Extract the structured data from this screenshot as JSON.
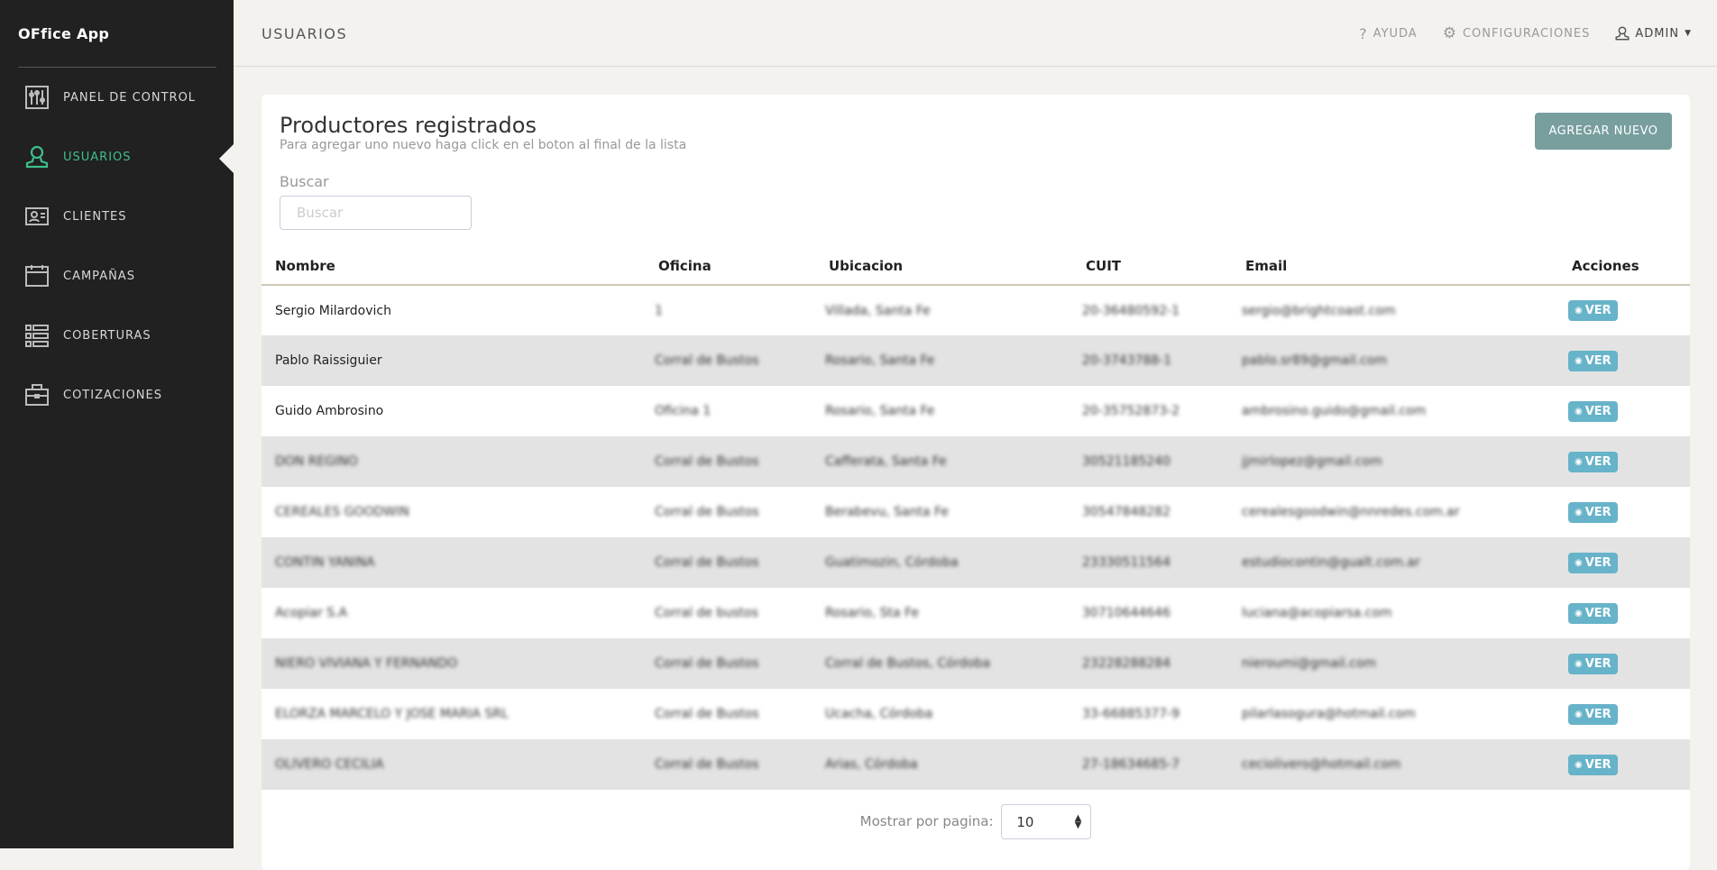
{
  "app": {
    "logo": "OFfice App"
  },
  "sidebar": {
    "items": [
      {
        "label": "PANEL DE CONTROL",
        "icon": "sliders-icon"
      },
      {
        "label": "USUARIOS",
        "icon": "user-icon",
        "active": true
      },
      {
        "label": "CLIENTES",
        "icon": "id-card-icon"
      },
      {
        "label": "CAMPAÑAS",
        "icon": "calendar-icon"
      },
      {
        "label": "COBERTURAS",
        "icon": "list-icon"
      },
      {
        "label": "COTIZACIONES",
        "icon": "briefcase-icon"
      }
    ]
  },
  "header": {
    "title": "USUARIOS",
    "help": "AYUDA",
    "settings": "CONFIGURACIONES",
    "user": "ADMIN"
  },
  "card": {
    "title": "Productores registrados",
    "subtitle": "Para agregar uno nuevo haga click en el boton al final de la lista",
    "add_label": "AGREGAR NUEVO",
    "search_label": "Buscar",
    "search_placeholder": "Buscar",
    "search_value": ""
  },
  "colors": {
    "accent": "#3fbf8a",
    "add_button": "#789e9e",
    "view_button": "#67b3c9",
    "sidebar": "#212121"
  },
  "table": {
    "headers": [
      "Nombre",
      "Oficina",
      "Ubicacion",
      "CUIT",
      "Email",
      "Acciones"
    ],
    "action_label": "VER",
    "rows": [
      [
        "Sergio Milardovich",
        "1",
        "Villada, Santa Fe",
        "20-36480592-1",
        "sergio@brightcoast.com"
      ],
      [
        "Pablo Raissiguier",
        "Corral de Bustos",
        "Rosario, Santa Fe",
        "20-3743788-1",
        "pablo.sr89@gmail.com"
      ],
      [
        "Guido Ambrosino",
        "Oficina 1",
        "Rosario, Santa Fe",
        "20-35752873-2",
        "ambrosino.guido@gmail.com"
      ],
      [
        "DON REGINO",
        "Corral de Bustos",
        "Cafferata, Santa Fe",
        "30521185240",
        "jjmirlopez@gmail.com"
      ],
      [
        "CEREALES GOODWIN",
        "Corral de Bustos",
        "Berabevu, Santa Fe",
        "30547848282",
        "cerealesgoodwin@nnredes.com.ar"
      ],
      [
        "CONTIN YANINA",
        "Corral de Bustos",
        "Guatimozin, Córdoba",
        "23330511564",
        "estudiocontin@gualt.com.ar"
      ],
      [
        "Acopiar S.A",
        "Corral de bustos",
        "Rosario, Sta Fe",
        "30710644646",
        "luciana@acopiarsa.com"
      ],
      [
        "NIERO VIVIANA Y FERNANDO",
        "Corral de Bustos",
        "Corral de Bustos, Córdoba",
        "23228288284",
        "nieroumi@gmail.com"
      ],
      [
        "ELORZA MARCELO Y JOSE MARIA SRL",
        "Corral de Bustos",
        "Ucacha, Córdoba",
        "33-66885377-9",
        "pilarlasogura@hotmail.com"
      ],
      [
        "OLIVERO CECILIA",
        "Corral de Bustos",
        "Arias, Córdoba",
        "27-18634685-7",
        "ceciolivero@hotmail.com"
      ]
    ]
  },
  "pagination": {
    "label": "Mostrar por pagina:",
    "per_page": "10"
  }
}
